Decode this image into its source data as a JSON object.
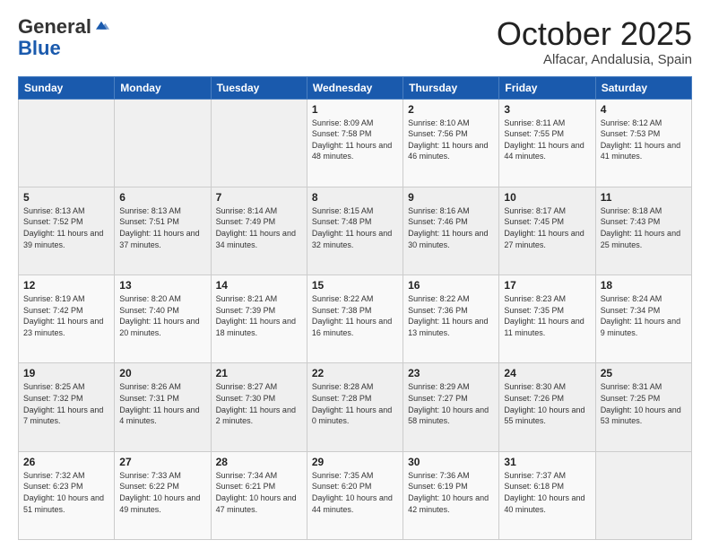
{
  "header": {
    "logo_general": "General",
    "logo_blue": "Blue",
    "month_title": "October 2025",
    "location": "Alfacar, Andalusia, Spain"
  },
  "weekdays": [
    "Sunday",
    "Monday",
    "Tuesday",
    "Wednesday",
    "Thursday",
    "Friday",
    "Saturday"
  ],
  "weeks": [
    [
      {
        "day": "",
        "info": ""
      },
      {
        "day": "",
        "info": ""
      },
      {
        "day": "",
        "info": ""
      },
      {
        "day": "1",
        "info": "Sunrise: 8:09 AM\nSunset: 7:58 PM\nDaylight: 11 hours and 48 minutes."
      },
      {
        "day": "2",
        "info": "Sunrise: 8:10 AM\nSunset: 7:56 PM\nDaylight: 11 hours and 46 minutes."
      },
      {
        "day": "3",
        "info": "Sunrise: 8:11 AM\nSunset: 7:55 PM\nDaylight: 11 hours and 44 minutes."
      },
      {
        "day": "4",
        "info": "Sunrise: 8:12 AM\nSunset: 7:53 PM\nDaylight: 11 hours and 41 minutes."
      }
    ],
    [
      {
        "day": "5",
        "info": "Sunrise: 8:13 AM\nSunset: 7:52 PM\nDaylight: 11 hours and 39 minutes."
      },
      {
        "day": "6",
        "info": "Sunrise: 8:13 AM\nSunset: 7:51 PM\nDaylight: 11 hours and 37 minutes."
      },
      {
        "day": "7",
        "info": "Sunrise: 8:14 AM\nSunset: 7:49 PM\nDaylight: 11 hours and 34 minutes."
      },
      {
        "day": "8",
        "info": "Sunrise: 8:15 AM\nSunset: 7:48 PM\nDaylight: 11 hours and 32 minutes."
      },
      {
        "day": "9",
        "info": "Sunrise: 8:16 AM\nSunset: 7:46 PM\nDaylight: 11 hours and 30 minutes."
      },
      {
        "day": "10",
        "info": "Sunrise: 8:17 AM\nSunset: 7:45 PM\nDaylight: 11 hours and 27 minutes."
      },
      {
        "day": "11",
        "info": "Sunrise: 8:18 AM\nSunset: 7:43 PM\nDaylight: 11 hours and 25 minutes."
      }
    ],
    [
      {
        "day": "12",
        "info": "Sunrise: 8:19 AM\nSunset: 7:42 PM\nDaylight: 11 hours and 23 minutes."
      },
      {
        "day": "13",
        "info": "Sunrise: 8:20 AM\nSunset: 7:40 PM\nDaylight: 11 hours and 20 minutes."
      },
      {
        "day": "14",
        "info": "Sunrise: 8:21 AM\nSunset: 7:39 PM\nDaylight: 11 hours and 18 minutes."
      },
      {
        "day": "15",
        "info": "Sunrise: 8:22 AM\nSunset: 7:38 PM\nDaylight: 11 hours and 16 minutes."
      },
      {
        "day": "16",
        "info": "Sunrise: 8:22 AM\nSunset: 7:36 PM\nDaylight: 11 hours and 13 minutes."
      },
      {
        "day": "17",
        "info": "Sunrise: 8:23 AM\nSunset: 7:35 PM\nDaylight: 11 hours and 11 minutes."
      },
      {
        "day": "18",
        "info": "Sunrise: 8:24 AM\nSunset: 7:34 PM\nDaylight: 11 hours and 9 minutes."
      }
    ],
    [
      {
        "day": "19",
        "info": "Sunrise: 8:25 AM\nSunset: 7:32 PM\nDaylight: 11 hours and 7 minutes."
      },
      {
        "day": "20",
        "info": "Sunrise: 8:26 AM\nSunset: 7:31 PM\nDaylight: 11 hours and 4 minutes."
      },
      {
        "day": "21",
        "info": "Sunrise: 8:27 AM\nSunset: 7:30 PM\nDaylight: 11 hours and 2 minutes."
      },
      {
        "day": "22",
        "info": "Sunrise: 8:28 AM\nSunset: 7:28 PM\nDaylight: 11 hours and 0 minutes."
      },
      {
        "day": "23",
        "info": "Sunrise: 8:29 AM\nSunset: 7:27 PM\nDaylight: 10 hours and 58 minutes."
      },
      {
        "day": "24",
        "info": "Sunrise: 8:30 AM\nSunset: 7:26 PM\nDaylight: 10 hours and 55 minutes."
      },
      {
        "day": "25",
        "info": "Sunrise: 8:31 AM\nSunset: 7:25 PM\nDaylight: 10 hours and 53 minutes."
      }
    ],
    [
      {
        "day": "26",
        "info": "Sunrise: 7:32 AM\nSunset: 6:23 PM\nDaylight: 10 hours and 51 minutes."
      },
      {
        "day": "27",
        "info": "Sunrise: 7:33 AM\nSunset: 6:22 PM\nDaylight: 10 hours and 49 minutes."
      },
      {
        "day": "28",
        "info": "Sunrise: 7:34 AM\nSunset: 6:21 PM\nDaylight: 10 hours and 47 minutes."
      },
      {
        "day": "29",
        "info": "Sunrise: 7:35 AM\nSunset: 6:20 PM\nDaylight: 10 hours and 44 minutes."
      },
      {
        "day": "30",
        "info": "Sunrise: 7:36 AM\nSunset: 6:19 PM\nDaylight: 10 hours and 42 minutes."
      },
      {
        "day": "31",
        "info": "Sunrise: 7:37 AM\nSunset: 6:18 PM\nDaylight: 10 hours and 40 minutes."
      },
      {
        "day": "",
        "info": ""
      }
    ]
  ]
}
